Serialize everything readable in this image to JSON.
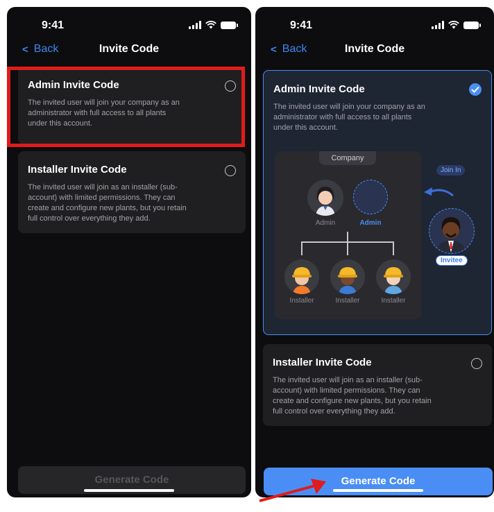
{
  "status": {
    "time": "9:41"
  },
  "nav": {
    "back_label": "Back",
    "title": "Invite Code"
  },
  "admin_card": {
    "title": "Admin Invite Code",
    "desc": "The invited user will join your company as an\nadministrator with full access to all plants\nunder this account."
  },
  "installer_card": {
    "title": "Installer Invite Code",
    "desc": "The invited user will join as an installer (sub-\naccount) with limited permissions. They can\ncreate and configure new plants, but you retain\nfull control over everything they add."
  },
  "diagram": {
    "company_label": "Company",
    "admin_gray_label": "Admin",
    "admin_blue_label": "Admin",
    "join_label": "Join In",
    "invitee_label": "Invitee",
    "installer_labels": [
      "Installer",
      "Installer",
      "Installer"
    ]
  },
  "generate_label": "Generate Code",
  "colors": {
    "accent": "#4a8ef5",
    "highlight": "#e01b1b",
    "card": "#1f1f22",
    "selected_card": "#1e2533"
  }
}
